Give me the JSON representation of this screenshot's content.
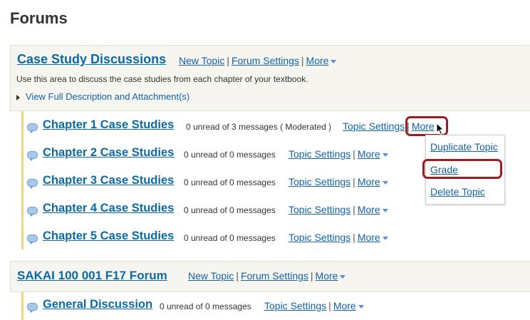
{
  "page_title": "Forums",
  "forums": [
    {
      "title": "Case Study Discussions",
      "new_topic": "New Topic",
      "settings": "Forum Settings",
      "more": "More",
      "description": "Use this area to discuss the case studies from each chapter of your textbook.",
      "view_full": "View Full Description and Attachment(s)",
      "topics": [
        {
          "title": "Chapter 1 Case Studies",
          "meta": "0 unread of 3 messages ( Moderated )",
          "settings": "Topic Settings",
          "more": "More"
        },
        {
          "title": "Chapter 2 Case Studies",
          "meta": "0 unread of 0 messages",
          "settings": "Topic Settings",
          "more": "More"
        },
        {
          "title": "Chapter 3 Case Studies",
          "meta": "0 unread of 0 messages",
          "settings": "Topic Settings",
          "more": "More"
        },
        {
          "title": "Chapter 4 Case Studies",
          "meta": "0 unread of 0 messages",
          "settings": "Topic Settings",
          "more": "More"
        },
        {
          "title": "Chapter 5 Case Studies",
          "meta": "0 unread of 0 messages",
          "settings": "Topic Settings",
          "more": "More"
        }
      ]
    },
    {
      "title": "SAKAI 100 001 F17 Forum",
      "new_topic": "New Topic",
      "settings": "Forum Settings",
      "more": "More",
      "topics": [
        {
          "title": "General Discussion",
          "meta": "0 unread of 0 messages",
          "settings": "Topic Settings",
          "more": "More"
        }
      ]
    }
  ],
  "more_menu": {
    "items": [
      "Duplicate Topic",
      "Grade",
      "Delete Topic"
    ]
  },
  "colors": {
    "link": "#1162aa",
    "highlight": "#9c1c23",
    "topic_border": "#f4d67a",
    "forum_bg": "#f7f5ef"
  }
}
